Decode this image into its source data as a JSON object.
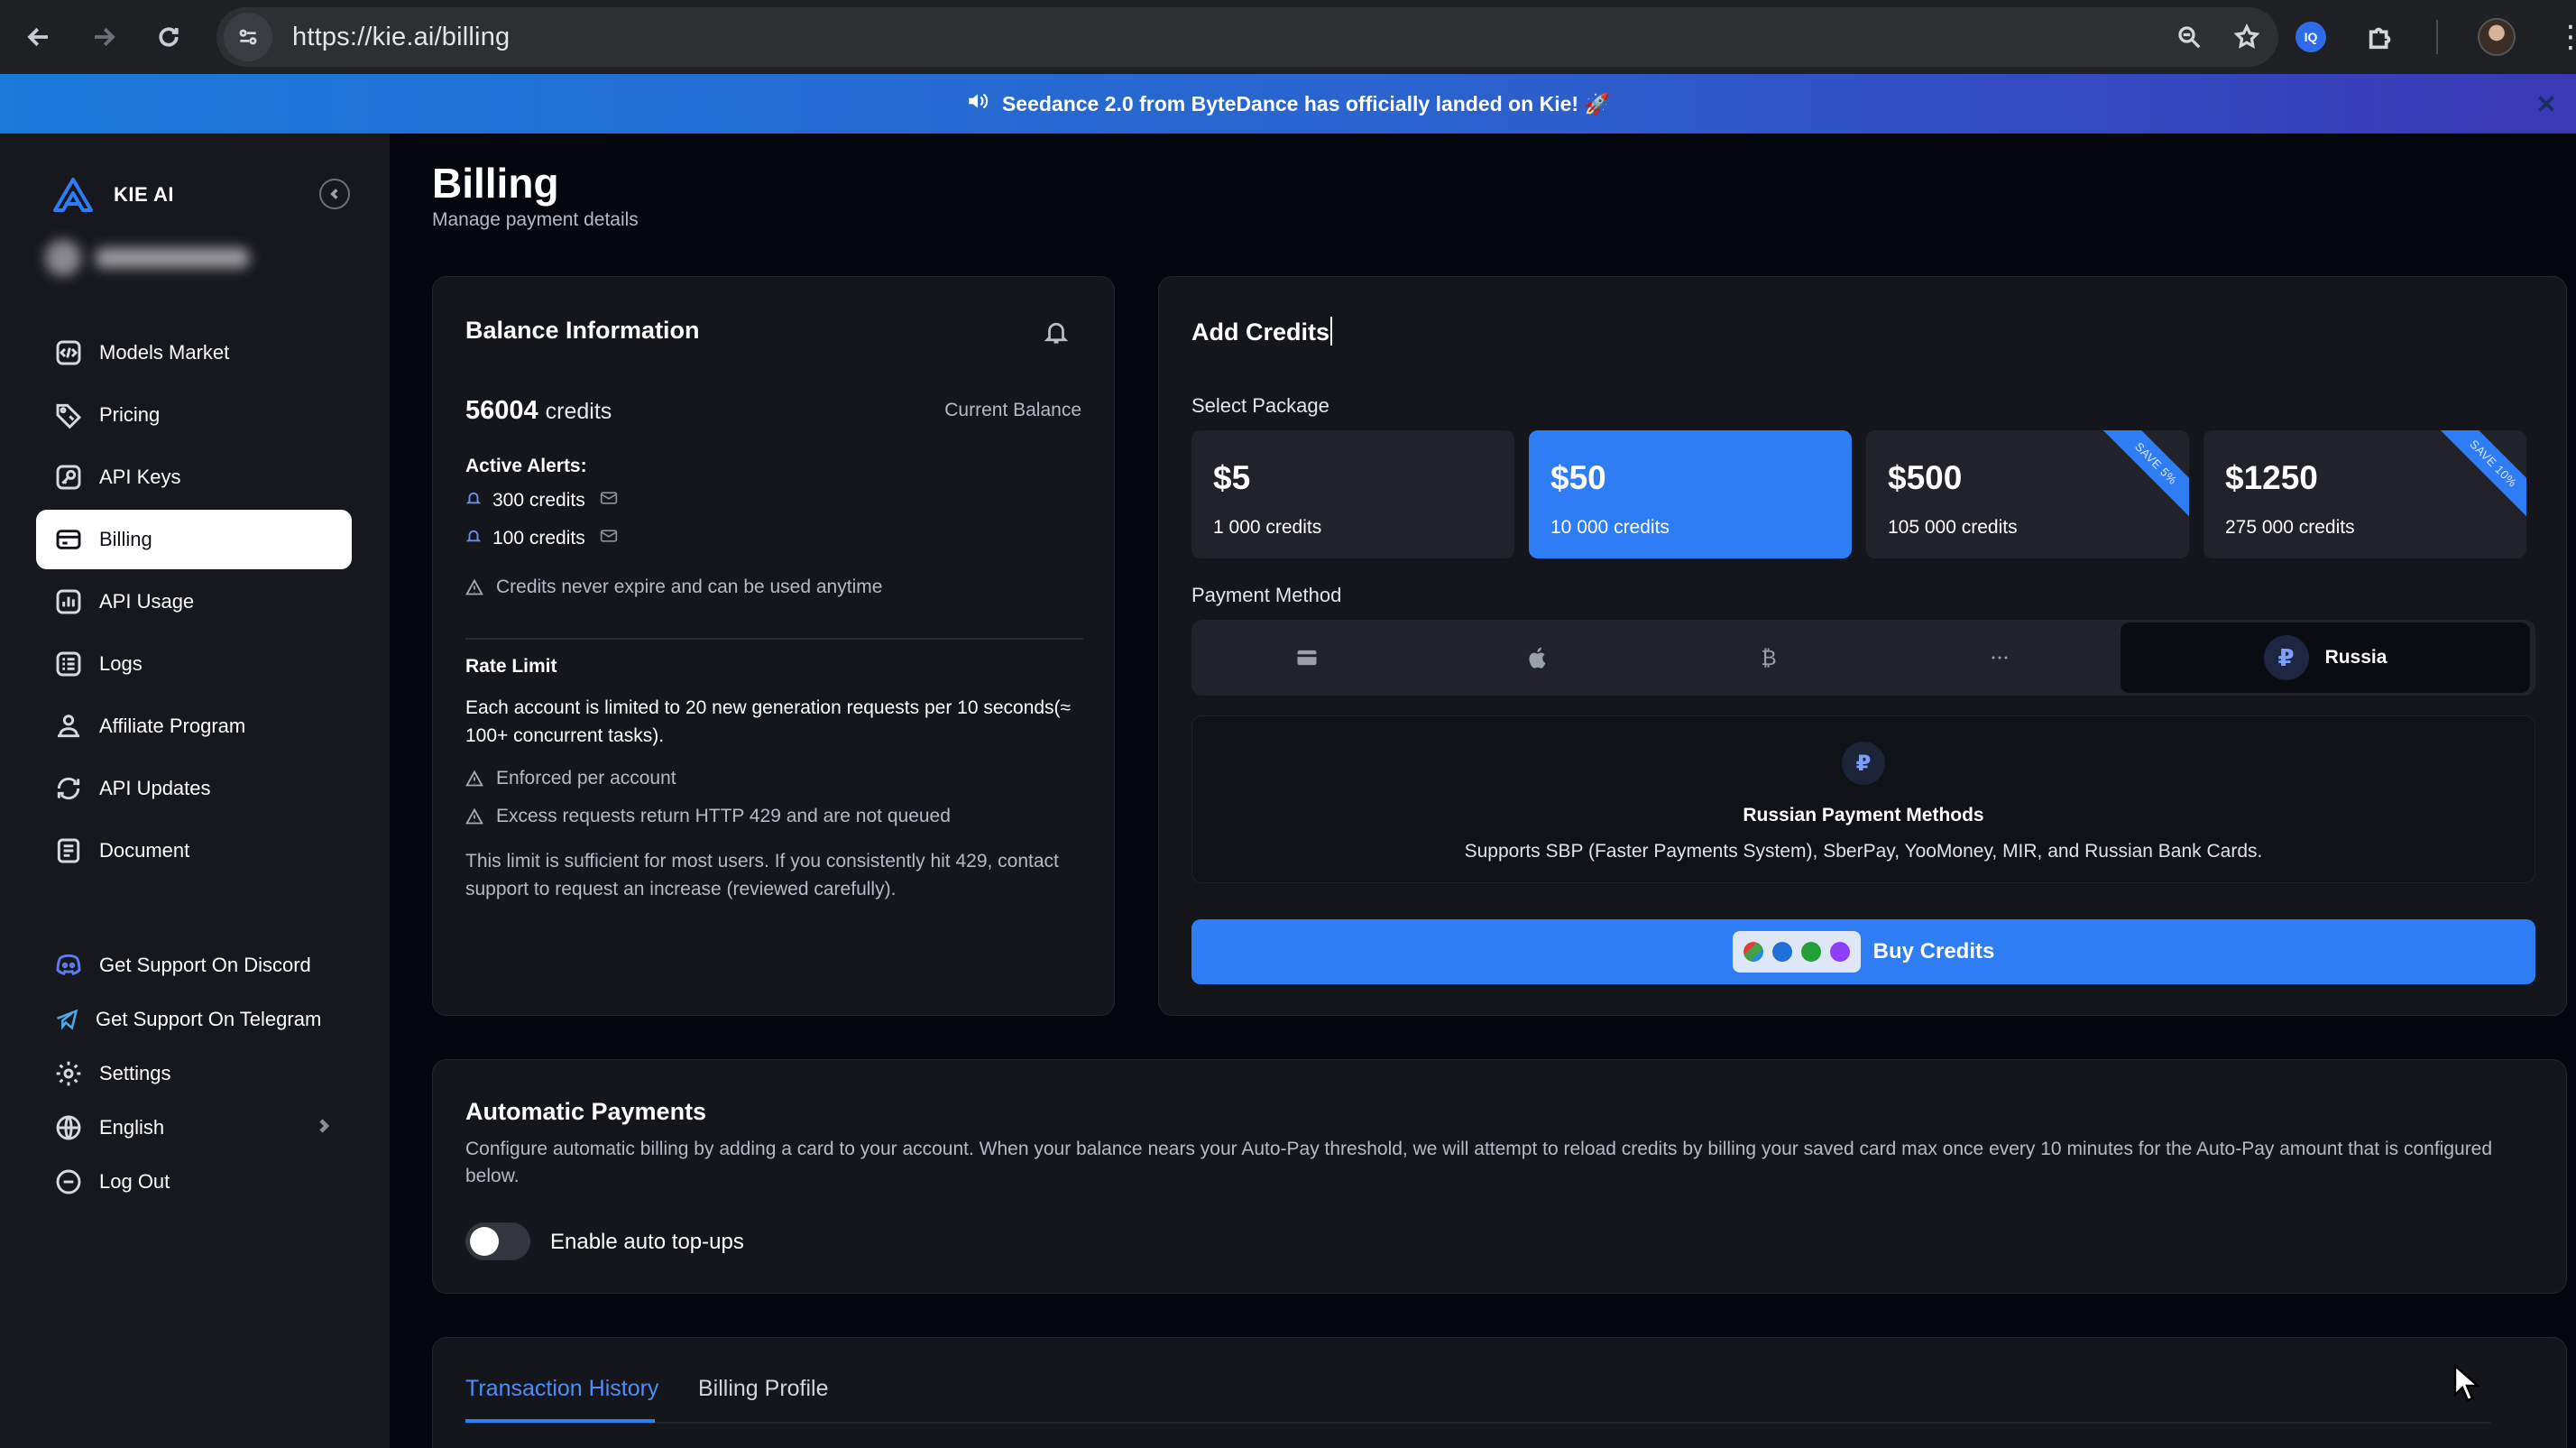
{
  "browser": {
    "url": "https://kie.ai/billing"
  },
  "banner": {
    "message": "Seedance 2.0 from ByteDance has officially landed on Kie! 🚀"
  },
  "sidebar": {
    "brand": "KIE AI",
    "items": [
      {
        "label": "Models Market",
        "icon": "code-icon"
      },
      {
        "label": "Pricing",
        "icon": "tag-icon"
      },
      {
        "label": "API Keys",
        "icon": "key-icon"
      },
      {
        "label": "Billing",
        "icon": "card-icon",
        "active": true
      },
      {
        "label": "API Usage",
        "icon": "chart-icon"
      },
      {
        "label": "Logs",
        "icon": "logs-icon"
      },
      {
        "label": "Affiliate Program",
        "icon": "affiliate-icon"
      },
      {
        "label": "API Updates",
        "icon": "refresh-icon"
      },
      {
        "label": "Document",
        "icon": "document-icon"
      }
    ],
    "support": [
      {
        "label": "Get Support On Discord",
        "icon": "discord-icon"
      },
      {
        "label": "Get Support On Telegram",
        "icon": "telegram-icon"
      },
      {
        "label": "Settings",
        "icon": "gear-icon"
      },
      {
        "label": "English",
        "icon": "globe-icon"
      },
      {
        "label": "Log Out",
        "icon": "logout-icon"
      }
    ]
  },
  "page": {
    "title": "Billing",
    "subtitle": "Manage payment details"
  },
  "balance": {
    "title": "Balance Information",
    "amount": "56004",
    "unit": "credits",
    "label": "Current Balance",
    "alerts_label": "Active Alerts:",
    "alerts": [
      "300 credits",
      "100 credits"
    ],
    "never_expire": "Credits never expire and can be used anytime",
    "rate_limit_title": "Rate Limit",
    "rate_limit_text": "Each account is limited to 20 new generation requests per 10 seconds(≈ 100+ concurrent tasks).",
    "enforced": "Enforced per account",
    "excess": "Excess requests return HTTP 429 and are not queued",
    "sufficient": "This limit is sufficient for most users. If you consistently hit 429, contact support to request an increase (reviewed carefully)."
  },
  "credits": {
    "title": "Add Credits",
    "select_package": "Select Package",
    "packages": [
      {
        "price": "$5",
        "credits": "1 000 credits",
        "ribbon": ""
      },
      {
        "price": "$50",
        "credits": "10 000 credits",
        "ribbon": "",
        "selected": true
      },
      {
        "price": "$500",
        "credits": "105 000 credits",
        "ribbon": "SAVE 5%"
      },
      {
        "price": "$1250",
        "credits": "275 000 credits",
        "ribbon": "SAVE 10%"
      }
    ],
    "payment_method": "Payment Method",
    "methods": [
      "card-icon",
      "apple-icon",
      "bitcoin-icon",
      "more-icon",
      "Russia"
    ],
    "russia_label": "Russia",
    "ruble_symbol": "₽",
    "ru_title": "Russian Payment Methods",
    "ru_desc": "Supports SBP (Faster Payments System), SberPay, YooMoney, MIR, and Russian Bank Cards.",
    "buy_label": "Buy Credits"
  },
  "auto": {
    "title": "Automatic Payments",
    "desc": "Configure automatic billing by adding a card to your account. When your balance nears your Auto-Pay threshold, we will attempt to reload credits by billing your saved card max once every 10 minutes for the Auto-Pay amount that is configured below.",
    "toggle_label": "Enable auto top-ups",
    "enabled": false
  },
  "tabs": {
    "items": [
      "Transaction History",
      "Billing Profile"
    ],
    "active": 0
  },
  "colors": {
    "accent": "#2f7df4",
    "background": "#05070f",
    "sidebar": "#17181d",
    "card": "#15161c"
  }
}
